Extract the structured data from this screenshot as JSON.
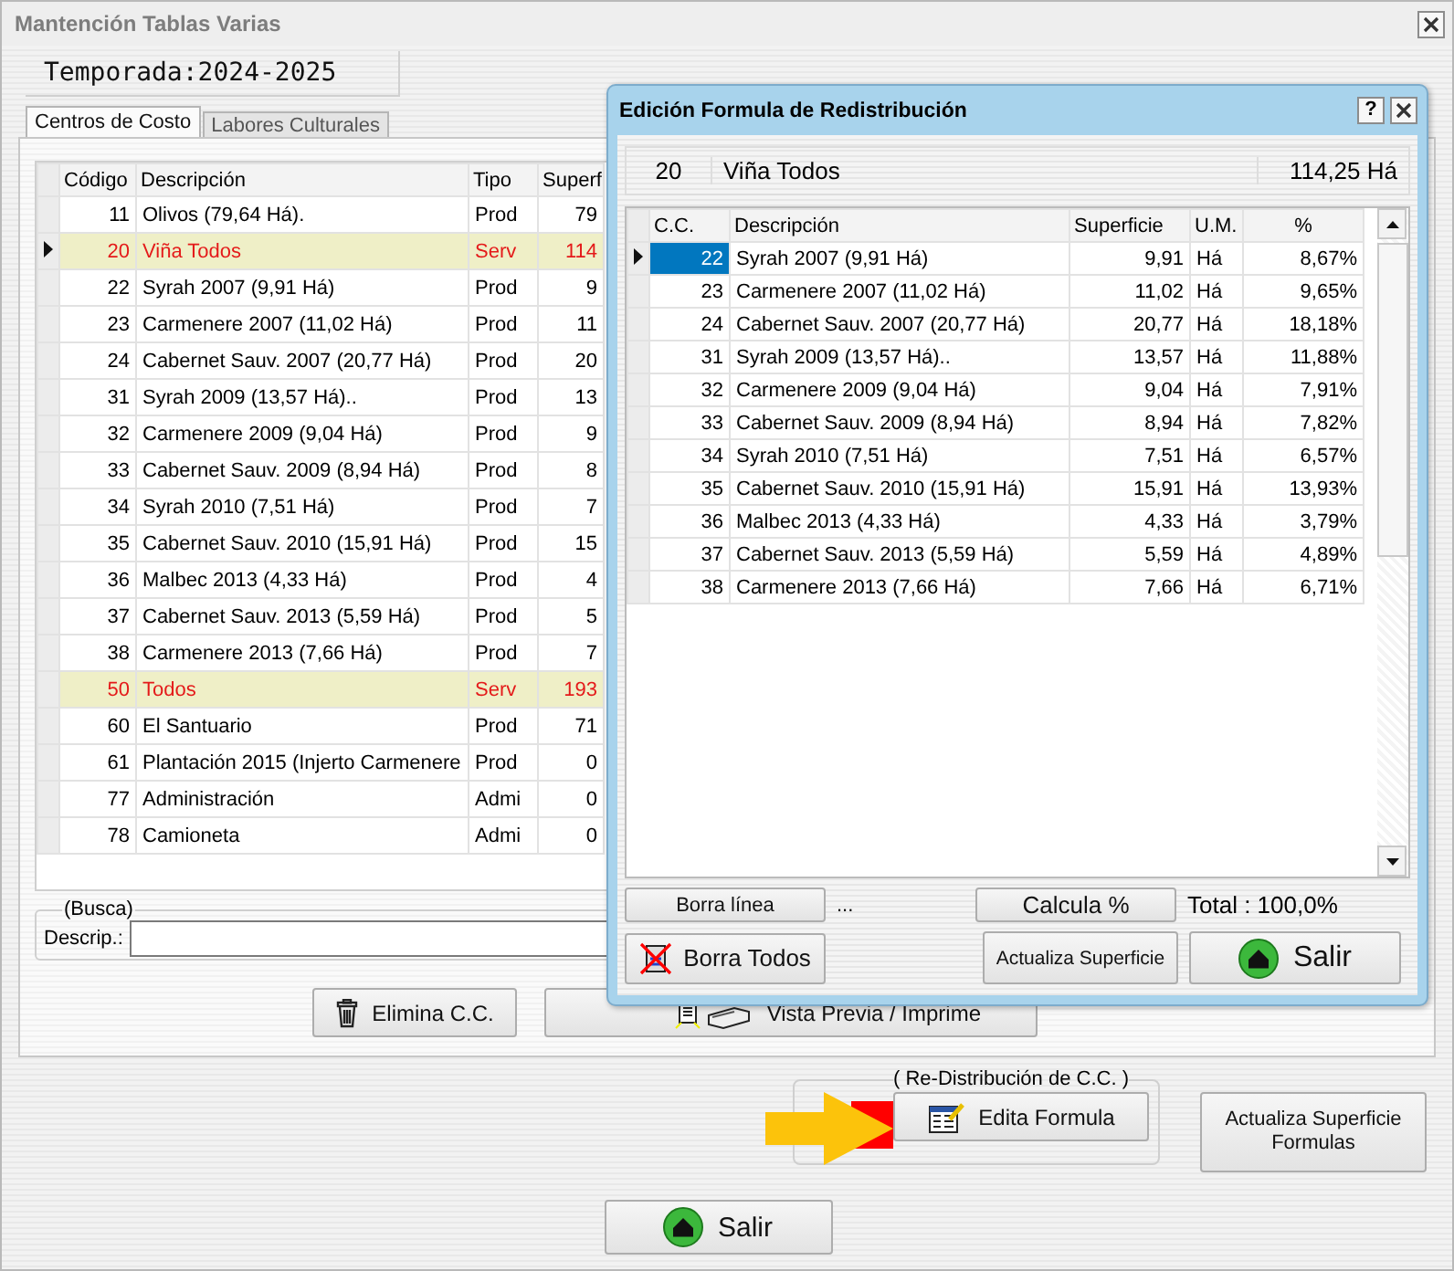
{
  "window": {
    "title": "Mantención Tablas Varias"
  },
  "season": "Temporada:2024-2025",
  "tabs": [
    {
      "label": "Centros de Costo",
      "selected": true
    },
    {
      "label": "Labores Culturales",
      "selected": false
    }
  ],
  "table": {
    "columns": [
      "Código",
      "Descripción",
      "Tipo",
      "Superf"
    ],
    "rows": [
      {
        "codigo": "11",
        "descripcion": "Olivos  (79,64 Há).",
        "tipo": "Prod",
        "superficie": "79",
        "highlighted": false,
        "selected": false
      },
      {
        "codigo": "20",
        "descripcion": "Viña Todos",
        "tipo": "Serv",
        "superficie": "114",
        "highlighted": true,
        "selected": true
      },
      {
        "codigo": "22",
        "descripcion": "Syrah 2007 (9,91 Há)",
        "tipo": "Prod",
        "superficie": "9",
        "highlighted": false,
        "selected": false
      },
      {
        "codigo": "23",
        "descripcion": "Carmenere 2007 (11,02 Há)",
        "tipo": "Prod",
        "superficie": "11",
        "highlighted": false,
        "selected": false
      },
      {
        "codigo": "24",
        "descripcion": "Cabernet Sauv. 2007 (20,77 Há)",
        "tipo": "Prod",
        "superficie": "20",
        "highlighted": false,
        "selected": false
      },
      {
        "codigo": "31",
        "descripcion": "Syrah 2009 (13,57 Há)..",
        "tipo": "Prod",
        "superficie": "13",
        "highlighted": false,
        "selected": false
      },
      {
        "codigo": "32",
        "descripcion": "Carmenere 2009 (9,04 Há)",
        "tipo": "Prod",
        "superficie": "9",
        "highlighted": false,
        "selected": false
      },
      {
        "codigo": "33",
        "descripcion": "Cabernet Sauv. 2009 (8,94 Há)",
        "tipo": "Prod",
        "superficie": "8",
        "highlighted": false,
        "selected": false
      },
      {
        "codigo": "34",
        "descripcion": "Syrah 2010 (7,51 Há)",
        "tipo": "Prod",
        "superficie": "7",
        "highlighted": false,
        "selected": false
      },
      {
        "codigo": "35",
        "descripcion": "Cabernet Sauv. 2010 (15,91 Há)",
        "tipo": "Prod",
        "superficie": "15",
        "highlighted": false,
        "selected": false
      },
      {
        "codigo": "36",
        "descripcion": "Malbec 2013 (4,33 Há)",
        "tipo": "Prod",
        "superficie": "4",
        "highlighted": false,
        "selected": false
      },
      {
        "codigo": "37",
        "descripcion": "Cabernet Sauv. 2013 (5,59 Há)",
        "tipo": "Prod",
        "superficie": "5",
        "highlighted": false,
        "selected": false
      },
      {
        "codigo": "38",
        "descripcion": "Carmenere 2013 (7,66 Há)",
        "tipo": "Prod",
        "superficie": "7",
        "highlighted": false,
        "selected": false
      },
      {
        "codigo": "50",
        "descripcion": "Todos",
        "tipo": "Serv",
        "superficie": "193",
        "highlighted": true,
        "selected": false
      },
      {
        "codigo": "60",
        "descripcion": "El Santuario",
        "tipo": "Prod",
        "superficie": "71",
        "highlighted": false,
        "selected": false
      },
      {
        "codigo": "61",
        "descripcion": "Plantación 2015 (Injerto Carmenere",
        "tipo": "Prod",
        "superficie": "0",
        "highlighted": false,
        "selected": false
      },
      {
        "codigo": "77",
        "descripcion": "Administración",
        "tipo": "Admi",
        "superficie": "0",
        "highlighted": false,
        "selected": false
      },
      {
        "codigo": "78",
        "descripcion": "Camioneta",
        "tipo": "Admi",
        "superficie": "0",
        "highlighted": false,
        "selected": false
      }
    ]
  },
  "search": {
    "legend": "(Busca)",
    "label": "Descrip.:"
  },
  "buttons": [
    {
      "kind": "delete",
      "label": "Elimina C.C."
    },
    {
      "kind": "print",
      "label": "Vista Previa / Imprime"
    }
  ],
  "redistribution": {
    "legend": "( Re-Distribución de C.C. )",
    "button": "Edita Formula"
  },
  "update_button": "Actualiza Superficie Formulas",
  "exit_button": "Salir",
  "dialog": {
    "title": "Edición Formula de Redistribución",
    "help": "?",
    "header": {
      "code": "20",
      "name": "Viña Todos",
      "area": "114,25 Há"
    },
    "table": {
      "columns": [
        "C.C.",
        "Descripción",
        "Superficie",
        "U.M.",
        "%"
      ],
      "rows": [
        {
          "cc": "22",
          "descripcion": "Syrah 2007 (9,91 Há)",
          "superficie": "9,91",
          "um": "Há",
          "pct": "8,67%",
          "selected": true
        },
        {
          "cc": "23",
          "descripcion": "Carmenere 2007 (11,02 Há)",
          "superficie": "11,02",
          "um": "Há",
          "pct": "9,65%",
          "selected": false
        },
        {
          "cc": "24",
          "descripcion": "Cabernet Sauv. 2007 (20,77 Há)",
          "superficie": "20,77",
          "um": "Há",
          "pct": "18,18%",
          "selected": false
        },
        {
          "cc": "31",
          "descripcion": "Syrah 2009 (13,57 Há)..",
          "superficie": "13,57",
          "um": "Há",
          "pct": "11,88%",
          "selected": false
        },
        {
          "cc": "32",
          "descripcion": "Carmenere 2009 (9,04 Há)",
          "superficie": "9,04",
          "um": "Há",
          "pct": "7,91%",
          "selected": false
        },
        {
          "cc": "33",
          "descripcion": "Cabernet Sauv. 2009 (8,94 Há)",
          "superficie": "8,94",
          "um": "Há",
          "pct": "7,82%",
          "selected": false
        },
        {
          "cc": "34",
          "descripcion": "Syrah 2010 (7,51 Há)",
          "superficie": "7,51",
          "um": "Há",
          "pct": "6,57%",
          "selected": false
        },
        {
          "cc": "35",
          "descripcion": "Cabernet Sauv. 2010 (15,91 Há)",
          "superficie": "15,91",
          "um": "Há",
          "pct": "13,93%",
          "selected": false
        },
        {
          "cc": "36",
          "descripcion": "Malbec 2013 (4,33 Há)",
          "superficie": "4,33",
          "um": "Há",
          "pct": "3,79%",
          "selected": false
        },
        {
          "cc": "37",
          "descripcion": "Cabernet Sauv. 2013 (5,59 Há)",
          "superficie": "5,59",
          "um": "Há",
          "pct": "4,89%",
          "selected": false
        },
        {
          "cc": "38",
          "descripcion": "Carmenere 2013 (7,66 Há)",
          "superficie": "7,66",
          "um": "Há",
          "pct": "6,71%",
          "selected": false
        }
      ]
    },
    "delete_line": "Borra línea",
    "ellipsis": "...",
    "calc": "Calcula %",
    "total": "Total :  100,0%",
    "delete_all": "Borra Todos",
    "update": "Actualiza Superficie",
    "exit": "Salir"
  }
}
